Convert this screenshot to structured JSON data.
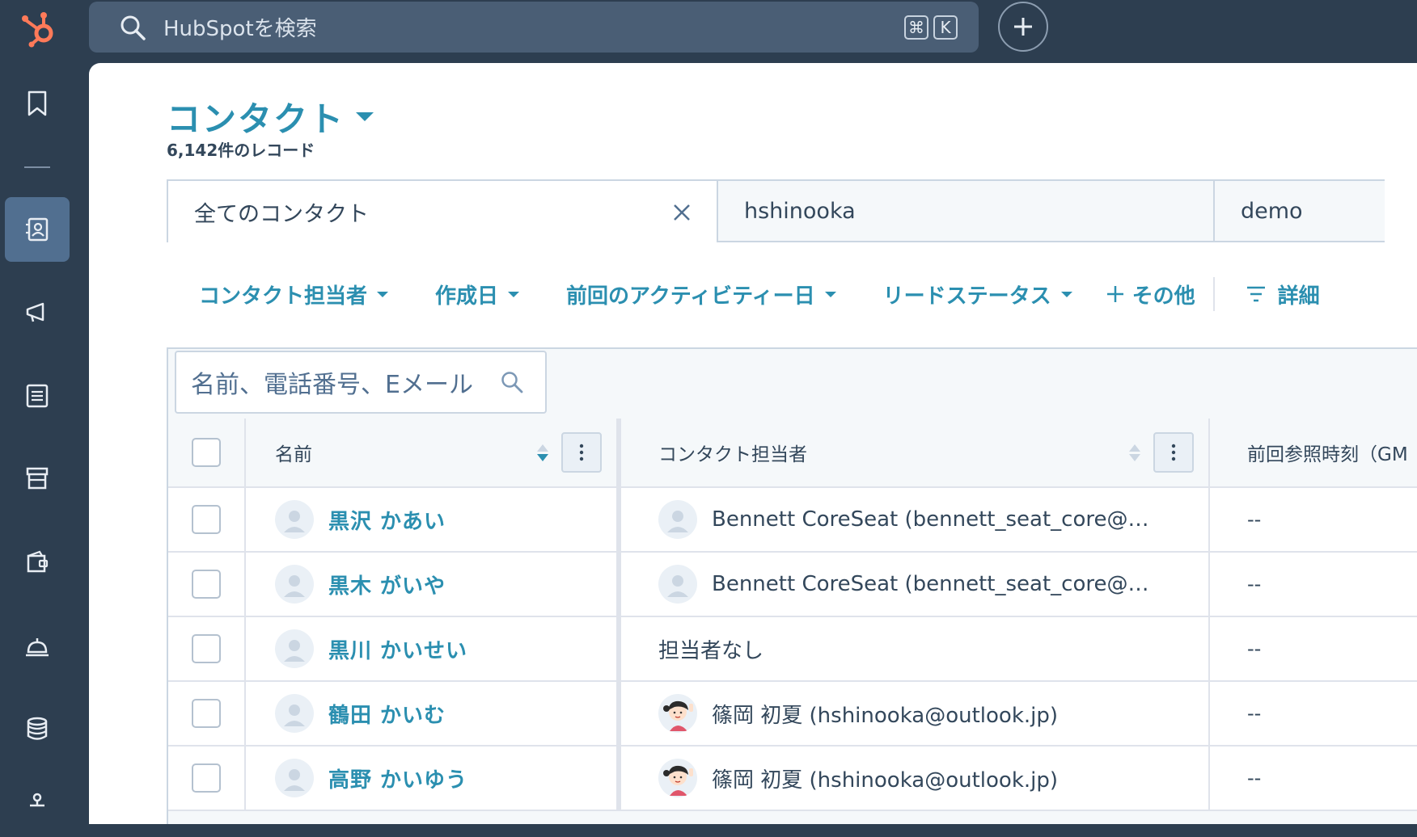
{
  "topbar": {
    "search_placeholder": "HubSpotを検索",
    "shortcut_key1": "⌘",
    "shortcut_key2": "K"
  },
  "sidebar": {
    "items": [
      {
        "name": "bookmark-icon"
      },
      {
        "name": "contacts-icon",
        "active": true
      },
      {
        "name": "marketing-megaphone-icon"
      },
      {
        "name": "content-icon"
      },
      {
        "name": "commerce-icon"
      },
      {
        "name": "sales-wallet-icon"
      },
      {
        "name": "service-bell-icon"
      },
      {
        "name": "data-database-icon"
      },
      {
        "name": "automation-icon"
      }
    ]
  },
  "header": {
    "title": "コンタクト",
    "record_count": "6,142件のレコード"
  },
  "views": {
    "tabs": [
      {
        "label": "全てのコンタクト"
      },
      {
        "label": "hshinooka"
      },
      {
        "label": "demo"
      }
    ]
  },
  "filters": {
    "items": [
      {
        "label": "コンタクト担当者"
      },
      {
        "label": "作成日"
      },
      {
        "label": "前回のアクティビティー日"
      },
      {
        "label": "リードステータス"
      }
    ],
    "more_label": "その他",
    "advanced_label": "詳細"
  },
  "table": {
    "search_placeholder": "名前、電話番号、Eメール",
    "columns": {
      "name": "名前",
      "owner": "コンタクト担当者",
      "last_viewed": "前回参照時刻（GM"
    },
    "rows": [
      {
        "name": "黒沢 かあい",
        "owner": "Bennett CoreSeat (bennett_seat_core@…",
        "owner_avatar": "placeholder",
        "last": "--"
      },
      {
        "name": "黒木 がいや",
        "owner": "Bennett CoreSeat (bennett_seat_core@…",
        "owner_avatar": "placeholder",
        "last": "--"
      },
      {
        "name": "黒川 かいせい",
        "owner": "担当者なし",
        "owner_avatar": "none",
        "last": "--"
      },
      {
        "name": "鶴田 かいむ",
        "owner": "篠岡 初夏 (hshinooka@outlook.jp)",
        "owner_avatar": "illustration",
        "last": "--"
      },
      {
        "name": "高野 かいゆう",
        "owner": "篠岡 初夏 (hshinooka@outlook.jp)",
        "owner_avatar": "illustration",
        "last": "--"
      }
    ]
  },
  "colors": {
    "nav_bg": "#2d3e50",
    "accent": "#2b8fb0",
    "text": "#33475b",
    "border": "#cbd6e2",
    "hubspot_orange": "#ff7a59"
  }
}
